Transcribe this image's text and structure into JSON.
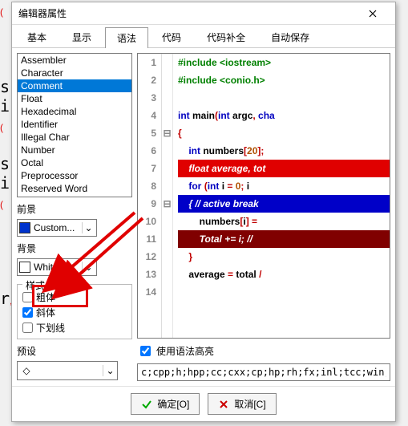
{
  "dialog": {
    "title": "编辑器属性",
    "close": "×",
    "tabs": [
      "基本",
      "显示",
      "语法",
      "代码",
      "代码补全",
      "自动保存"
    ],
    "active_tab": 2
  },
  "syntax_list": {
    "items": [
      "Assembler",
      "Character",
      "Comment",
      "Float",
      "Hexadecimal",
      "Identifier",
      "Illegal Char",
      "Number",
      "Octal",
      "Preprocessor",
      "Reserved Word"
    ],
    "selected": 2
  },
  "foreground": {
    "label": "前景",
    "value": "Custom...",
    "swatch": "#0033cc"
  },
  "background": {
    "label": "背景",
    "value": "White",
    "swatch": "#ffffff"
  },
  "style_group": {
    "title": "样式",
    "bold": {
      "label": "粗体",
      "checked": false
    },
    "italic": {
      "label": "斜体",
      "checked": true
    },
    "underline": {
      "label": "下划线",
      "checked": false
    }
  },
  "preset": {
    "label": "预设"
  },
  "enable_highlight": {
    "label": "使用语法高亮",
    "checked": true
  },
  "extensions_value": "c;cpp;h;hpp;cc;cxx;cp;hp;rh;fx;inl;tcc;win;;",
  "buttons": {
    "ok": "确定[O]",
    "cancel": "取消[C]"
  },
  "code_preview": {
    "lines": [
      {
        "n": 1,
        "segments": [
          {
            "t": "#include <iostream>",
            "cls": "tok-pre"
          }
        ]
      },
      {
        "n": 2,
        "segments": [
          {
            "t": "#include <conio.h>",
            "cls": "tok-pre"
          }
        ]
      },
      {
        "n": 3,
        "segments": []
      },
      {
        "n": 4,
        "segments": [
          {
            "t": "int ",
            "cls": "tok-kw"
          },
          {
            "t": "main",
            "cls": "tok-ident"
          },
          {
            "t": "(",
            "cls": "tok-punc"
          },
          {
            "t": "int ",
            "cls": "tok-kw"
          },
          {
            "t": "argc",
            "cls": "tok-ident"
          },
          {
            "t": ", ",
            "cls": "tok-punc"
          },
          {
            "t": "cha",
            "cls": "tok-kw"
          }
        ]
      },
      {
        "n": 5,
        "fold": "⊟",
        "segments": [
          {
            "t": "{",
            "cls": "tok-punc"
          }
        ]
      },
      {
        "n": 6,
        "segments": [
          {
            "t": "    ",
            "cls": ""
          },
          {
            "t": "int ",
            "cls": "tok-kw"
          },
          {
            "t": "numbers",
            "cls": "tok-ident"
          },
          {
            "t": "[",
            "cls": "tok-punc"
          },
          {
            "t": "20",
            "cls": "tok-num"
          },
          {
            "t": "];",
            "cls": "tok-punc"
          }
        ]
      },
      {
        "n": 7,
        "hl": "red",
        "text": "    float average, tot"
      },
      {
        "n": 8,
        "segments": [
          {
            "t": "    ",
            "cls": ""
          },
          {
            "t": "for ",
            "cls": "tok-kw"
          },
          {
            "t": "(",
            "cls": "tok-punc"
          },
          {
            "t": "int ",
            "cls": "tok-kw"
          },
          {
            "t": "i ",
            "cls": "tok-ident"
          },
          {
            "t": "= ",
            "cls": "tok-punc"
          },
          {
            "t": "0",
            "cls": "tok-num"
          },
          {
            "t": "; ",
            "cls": "tok-punc"
          },
          {
            "t": "i",
            "cls": "tok-ident"
          }
        ]
      },
      {
        "n": 9,
        "fold": "⊟",
        "hl": "blue",
        "text": "    { // active break"
      },
      {
        "n": 10,
        "segments": [
          {
            "t": "        numbers",
            "cls": "tok-ident"
          },
          {
            "t": "[",
            "cls": "tok-punc"
          },
          {
            "t": "i",
            "cls": "tok-ident"
          },
          {
            "t": "] = ",
            "cls": "tok-punc"
          }
        ]
      },
      {
        "n": 11,
        "hl": "maroon",
        "text": "        Total += i; //"
      },
      {
        "n": 12,
        "segments": [
          {
            "t": "    }",
            "cls": "tok-punc"
          }
        ]
      },
      {
        "n": 13,
        "segments": [
          {
            "t": "    average ",
            "cls": "tok-ident"
          },
          {
            "t": "= ",
            "cls": "tok-punc"
          },
          {
            "t": "total ",
            "cls": "tok-ident"
          },
          {
            "t": "/",
            "cls": "tok-punc"
          }
        ]
      },
      {
        "n": 14,
        "segments": []
      }
    ]
  }
}
